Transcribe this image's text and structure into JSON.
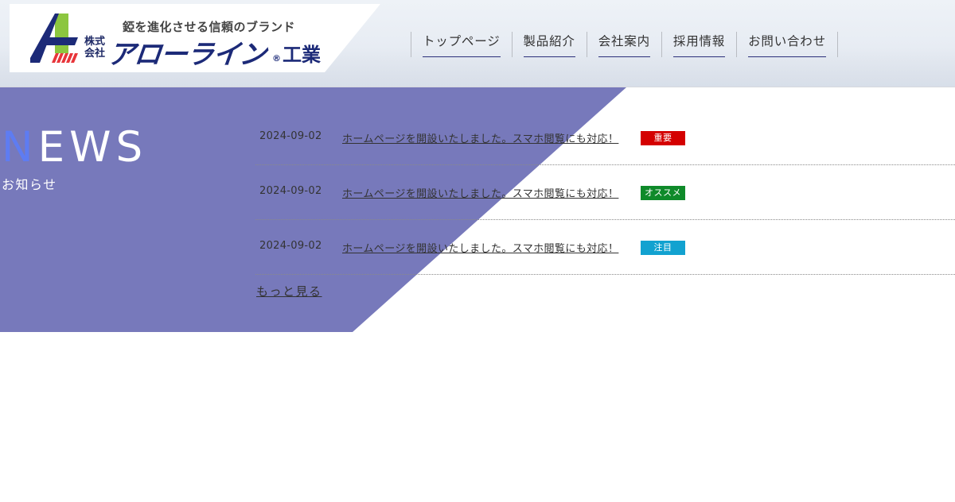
{
  "header": {
    "logo": {
      "tagline": "錏を進化させる信頼のブランド",
      "kabushiki": "株式",
      "kaisha": "会社",
      "brand_name": "アローライン",
      "registered": "®",
      "suffix": "工業",
      "mark_colors": {
        "navy": "#1c2a78",
        "green": "#8cc63f",
        "red": "#e8353a"
      }
    },
    "nav": [
      {
        "label": "トップページ"
      },
      {
        "label": "製品紹介"
      },
      {
        "label": "会社案内"
      },
      {
        "label": "採用情報"
      },
      {
        "label": "お問い合わせ"
      }
    ]
  },
  "news": {
    "title_first_letter": "N",
    "title_rest": "EWS",
    "subtitle": "お知らせ",
    "band_color": "#7779bb",
    "items": [
      {
        "date": "2024-09-02",
        "text": "ホームページを開設いたしました。スマホ閲覧にも対応！",
        "badge": "重要",
        "badge_color": "#d40000"
      },
      {
        "date": "2024-09-02",
        "text": "ホームページを開設いたしました。スマホ閲覧にも対応！",
        "badge": "オススメ",
        "badge_color": "#0f8a2a"
      },
      {
        "date": "2024-09-02",
        "text": "ホームページを開設いたしました。スマホ閲覧にも対応！",
        "badge": "注目",
        "badge_color": "#12a2d0"
      }
    ],
    "more_label": "もっと見る"
  }
}
